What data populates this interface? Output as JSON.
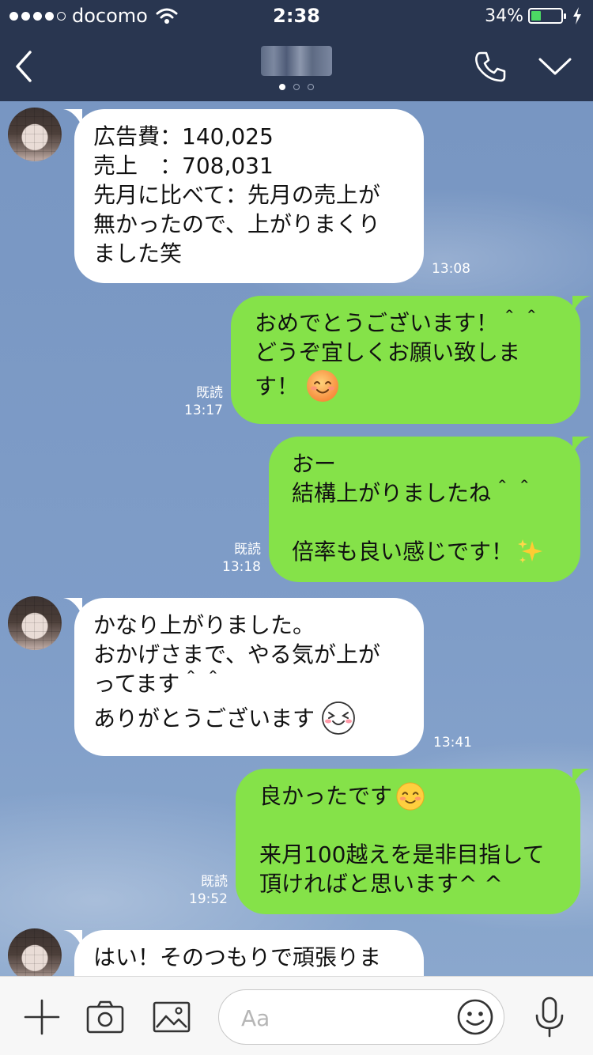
{
  "status": {
    "carrier": "docomo",
    "time": "2:38",
    "battery_label": "34%",
    "battery_level": 0.34,
    "signal_dots_filled": 4
  },
  "header": {
    "contact_name_blurred": true,
    "page_indicator": {
      "count": 3,
      "active": 0
    },
    "icons": [
      "back-chevron-icon",
      "phone-icon",
      "chevron-down-icon"
    ]
  },
  "messages": [
    {
      "side": "in",
      "lines": [
        "広告費：140,025",
        "売上　：708,031",
        "先月に比べて：先月の売上が",
        "無かったので、上がりまくり",
        "ました笑"
      ],
      "time": "13:08"
    },
    {
      "side": "out",
      "lines": [
        "おめでとうございます！＾＾",
        "どうぞ宜しくお願い致しま",
        "す！"
      ],
      "emoji": "smiling-face-emoji",
      "read": "既読",
      "time": "13:17"
    },
    {
      "side": "out",
      "lines": [
        "おー",
        "結構上がりましたね＾＾",
        "",
        "倍率も良い感じです！"
      ],
      "emoji": "sparkles-emoji",
      "read": "既読",
      "time": "13:18"
    },
    {
      "side": "in",
      "lines": [
        "かなり上がりました。",
        "おかげさまで、やる気が上が",
        "ってます＾＾",
        "ありがとうございます"
      ],
      "emoji": "laughing-face-emoji",
      "time": "13:41"
    },
    {
      "side": "out",
      "lines": [
        "良かったです",
        "",
        "来月100越えを是非目指して",
        "頂ければと思います^ ^"
      ],
      "emoji": "blushing-face-emoji",
      "read": "既読",
      "time": "19:52"
    },
    {
      "side": "in",
      "lines": [
        "はい！そのつもりで頑張りま"
      ]
    }
  ],
  "input": {
    "placeholder": "Aa",
    "icons": [
      "plus-icon",
      "camera-icon",
      "image-icon",
      "emoji-icon",
      "microphone-icon"
    ]
  },
  "colors": {
    "header_bg": "#293650",
    "chat_bg": "#7f9dc8",
    "outgoing_bubble": "#85e249",
    "incoming_bubble": "#ffffff",
    "battery_green": "#4cd964"
  }
}
